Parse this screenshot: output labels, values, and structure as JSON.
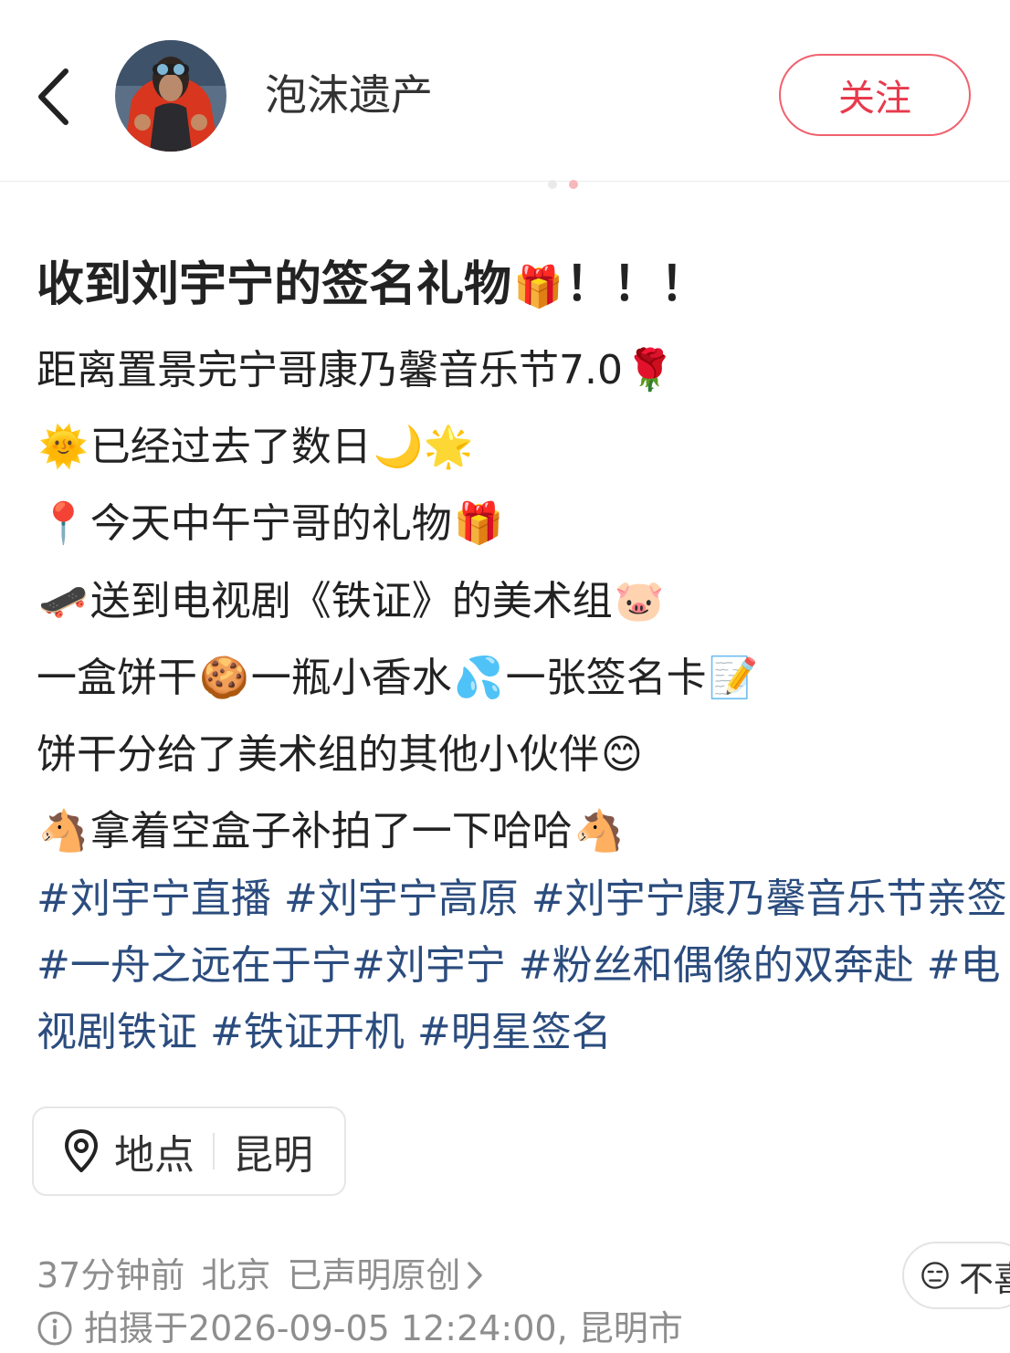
{
  "header": {
    "author_name": "泡沫遗产",
    "follow_label": "关注",
    "back_icon": "chevron-left-icon",
    "accent_color": "#e83a4c"
  },
  "post": {
    "title_text": "收到刘宇宁的签名礼物",
    "title_emoji": "🎁",
    "title_suffix": "！！！",
    "lines": [
      {
        "lead": "",
        "text": "距离置景完宁哥康乃馨音乐节7.0",
        "trail": "🌹"
      },
      {
        "lead": "🌞",
        "text": "已经过去了数日",
        "trail": "🌙🌟"
      },
      {
        "lead": "📍",
        "text": "今天中午宁哥的礼物",
        "trail": "🎁"
      },
      {
        "lead": "🛹",
        "text": "送到电视剧《铁证》的美术组",
        "trail": "🐷"
      },
      {
        "lead": "",
        "text": "一盒饼干",
        "mid1": "🍪",
        "text2": "一瓶小香水",
        "mid2": "💦",
        "text3": "一张签名卡",
        "trail": "📝"
      },
      {
        "lead": "",
        "text": "饼干分给了美术组的其他小伙伴",
        "trail": "😊"
      },
      {
        "lead": "🐴",
        "text": "拿着空盒子补拍了一下哈哈",
        "trail": "🐴"
      }
    ],
    "tags": [
      "#刘宇宁直播",
      "#刘宇宁高原",
      "#刘宇宁康乃馨音乐节亲签",
      "#一舟之远在于宁",
      "#刘宇宁",
      "#粉丝和偶像的双奔赴",
      "#电视剧铁证",
      "#铁证开机",
      "#明星签名"
    ]
  },
  "location": {
    "icon": "location-pin-icon",
    "label": "地点",
    "city": "昆明"
  },
  "meta": {
    "time_ago": "37分钟前",
    "ip_region": "北京",
    "original": "已声明原创",
    "dislike_label": "不喜",
    "shot_info": "拍摄于2026-09-05 12:24:00, 昆明市"
  }
}
